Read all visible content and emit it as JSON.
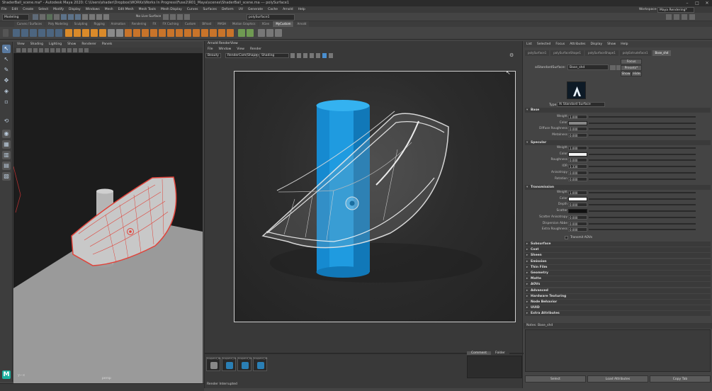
{
  "window": {
    "title": "ShaderBall_scene.ma* - Autodesk Maya 2020: C:\\Users\\shader\\Dropbox\\WORKs\\Works In Progress\\Fuse2\\R01_Maya\\scenes\\ShaderBall_scene.ma  ---  polySurface1"
  },
  "menubar": {
    "items": [
      "File",
      "Edit",
      "Create",
      "Select",
      "Modify",
      "Display",
      "Windows",
      "Mesh",
      "Edit Mesh",
      "Mesh Tools",
      "Mesh Display",
      "Curves",
      "Surfaces",
      "Deform",
      "UV",
      "Generate",
      "Cache",
      "Arnold",
      "Help"
    ],
    "workspace_label": "Workspace :",
    "workspace_value": "Maya Rendering*"
  },
  "statusline": {
    "mode": "Modeling",
    "live_surface": "No Live Surface",
    "object_name": "polySurface1"
  },
  "shelf": {
    "tabs": [
      "Curves / Surfaces",
      "Poly Modeling",
      "Sculpting",
      "Rigging",
      "Animation",
      "Rendering",
      "FX",
      "FX Caching",
      "Custom",
      "Bifrost",
      "MASH",
      "Motion Graphics",
      "XGen",
      "MyCustom",
      "Arnold"
    ],
    "active_tab": "MyCustom"
  },
  "viewport": {
    "menu": [
      "View",
      "Shading",
      "Lighting",
      "Show",
      "Renderer",
      "Panels"
    ],
    "camera_label": "persp"
  },
  "renderview": {
    "title": "Arnold RenderView",
    "menu": [
      "File",
      "Window",
      "View",
      "Render"
    ],
    "camera": "Beauty",
    "aov": "RenderCam(Shape)",
    "display": "Shading",
    "snapshots": [
      "Snapshot_00",
      "Snapshot_01",
      "Snapshot_02",
      "Snapshot_03"
    ],
    "tabs": [
      "Comment",
      "Folder"
    ],
    "status": "Render Interrupted"
  },
  "attribute_editor": {
    "menu": [
      "List",
      "Selected",
      "Focus",
      "Attributes",
      "Display",
      "Show",
      "Help"
    ],
    "node_tabs": [
      "polySurface1",
      "polySurfaceShape1",
      "polySurfaceShape1",
      "polyExtrudeFace1",
      "Base_shd"
    ],
    "node_type_label": "aiStandardSurface:",
    "node_name": "Base_shd",
    "buttons": {
      "focus": "Focus",
      "presets": "Presets*",
      "show": "Show",
      "hide": "Hide"
    },
    "type_label": "Type",
    "type_value": "Ai Standard Surface",
    "sections": {
      "base": "Base",
      "specular": "Specular",
      "transmission": "Transmission",
      "collapsed": [
        "Subsurface",
        "Coat",
        "Sheen",
        "Emission",
        "Thin Film",
        "Geometry",
        "Matte",
        "AOVs",
        "Advanced",
        "Hardware Texturing",
        "Node Behavior",
        "UUID",
        "Extra Attributes"
      ]
    },
    "base_attrs": [
      {
        "label": "Weight",
        "value": "1.000"
      },
      {
        "label": "Color",
        "value": ""
      },
      {
        "label": "Diffuse Roughness",
        "value": "0.000"
      },
      {
        "label": "Metalness",
        "value": "0.000"
      }
    ],
    "specular_attrs": [
      {
        "label": "Weight",
        "value": "1.000"
      },
      {
        "label": "Color",
        "value": ""
      },
      {
        "label": "Roughness",
        "value": "0.000"
      },
      {
        "label": "IOR",
        "value": "1.330"
      },
      {
        "label": "Anisotropy",
        "value": "0.000"
      },
      {
        "label": "Rotation",
        "value": "0.000"
      }
    ],
    "transmission_attrs": [
      {
        "label": "Weight",
        "value": "1.000"
      },
      {
        "label": "Color",
        "value": ""
      },
      {
        "label": "Depth",
        "value": "0.000"
      },
      {
        "label": "Scatter",
        "value": ""
      },
      {
        "label": "Scatter Anisotropy",
        "value": "0.000"
      },
      {
        "label": "Dispersion Abbe",
        "value": "0.000"
      },
      {
        "label": "Extra Roughness",
        "value": "0.000"
      }
    ],
    "transmit_aovs_label": "Transmit AOVs",
    "notes_label": "Notes: Base_shd",
    "bottom_buttons": [
      "Select",
      "Load Attributes",
      "Copy Tab"
    ]
  },
  "colors": {
    "cylinder_blue": "#1f9be0",
    "selection_red": "#e0433a",
    "background": "#444444"
  }
}
